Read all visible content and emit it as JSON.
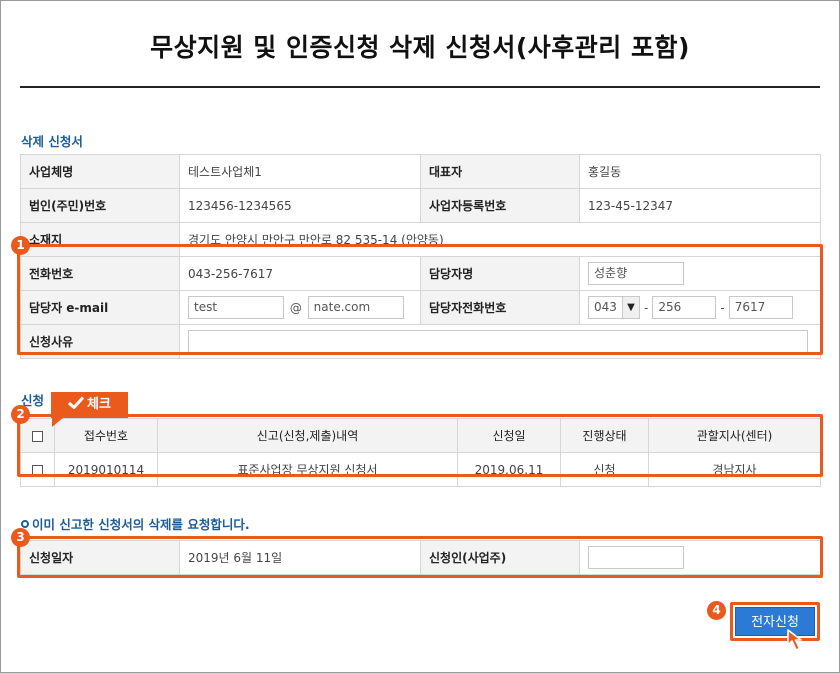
{
  "page": {
    "title": "무상지원 및 인증신청 삭제 신청서(사후관리 포함)"
  },
  "section1": {
    "title": "삭제 신청서",
    "company_label": "사업체명",
    "company_value": "테스트사업체1",
    "ceo_label": "대표자",
    "ceo_value": "홍길동",
    "corp_no_label": "법인(주민)번호",
    "corp_no_value": "123456-1234565",
    "biz_no_label": "사업자등록번호",
    "biz_no_value": "123-45-12347",
    "address_label": "소재지",
    "address_value": "경기도 안양시 만안구 만안로 82 535-14 (안양동)",
    "phone_label": "전화번호",
    "phone_value": "043-256-7617",
    "manager_label": "담당자명",
    "manager_value": "성춘향",
    "email_label": "담당자 e-mail",
    "email_id": "test",
    "email_at": "@",
    "email_domain": "nate.com",
    "manager_phone_label": "담당자전화번호",
    "manager_phone_1": "043",
    "manager_phone_sep1": "-",
    "manager_phone_2": "256",
    "manager_phone_sep2": "-",
    "manager_phone_3": "7617",
    "reason_label": "신청사유",
    "reason_value": ""
  },
  "section2": {
    "title": "신청",
    "check_tag": "체크",
    "check_icon": "checkmark-icon",
    "headers": [
      "접수번호",
      "신고(신청,제출)내역",
      "신청일",
      "진행상태",
      "관할지사(센터)"
    ],
    "rows": [
      [
        "2019010114",
        "표준사업장 무상지원 신청서",
        "2019.06.11",
        "신청",
        "경남지사"
      ]
    ]
  },
  "section3": {
    "notice": "이미 신고한 신청서의 삭제를 요청합니다.",
    "date_label": "신청일자",
    "date_value": "2019년 6월 11일",
    "applicant_label": "신청인(사업주)",
    "applicant_value": ""
  },
  "submit": {
    "label": "전자신청"
  },
  "markers": [
    "1",
    "2",
    "3",
    "4"
  ],
  "colors": {
    "highlight": "#ea5a1c",
    "primary": "#2b7bd6",
    "section_title": "#1f5d96"
  }
}
